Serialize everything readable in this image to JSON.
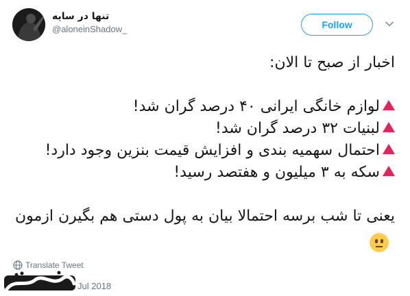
{
  "user": {
    "display_name": "تنها در سایه",
    "handle": "@aloneinShadow_"
  },
  "actions": {
    "follow_label": "Follow",
    "menu_icon": "chevron-down-icon"
  },
  "tweet": {
    "lines": [
      "اخبار از صبح تا الان:",
      "لوازم خانگی ایرانی ۴۰ درصد گران شد!",
      "لبنیات ۳۲ درصد گران شد!",
      "احتمال سهمیه بندی و افزایش قیمت بنزین وجود دارد!",
      "سکه به ۳ میلیون و هفتصد رسید!",
      "یعنی تا شب برسه احتمالا بیان به پول دستی هم بگیرن ازمون"
    ],
    "bullet_icon": "red-triangle-icon",
    "emoji_icon": "neutral-face-icon"
  },
  "footer": {
    "translate_label": "Translate Tweet",
    "timestamp": "Jul 2018"
  },
  "colors": {
    "accent": "#1da1f2",
    "bullet": "#e0245e",
    "muted": "#657786"
  }
}
